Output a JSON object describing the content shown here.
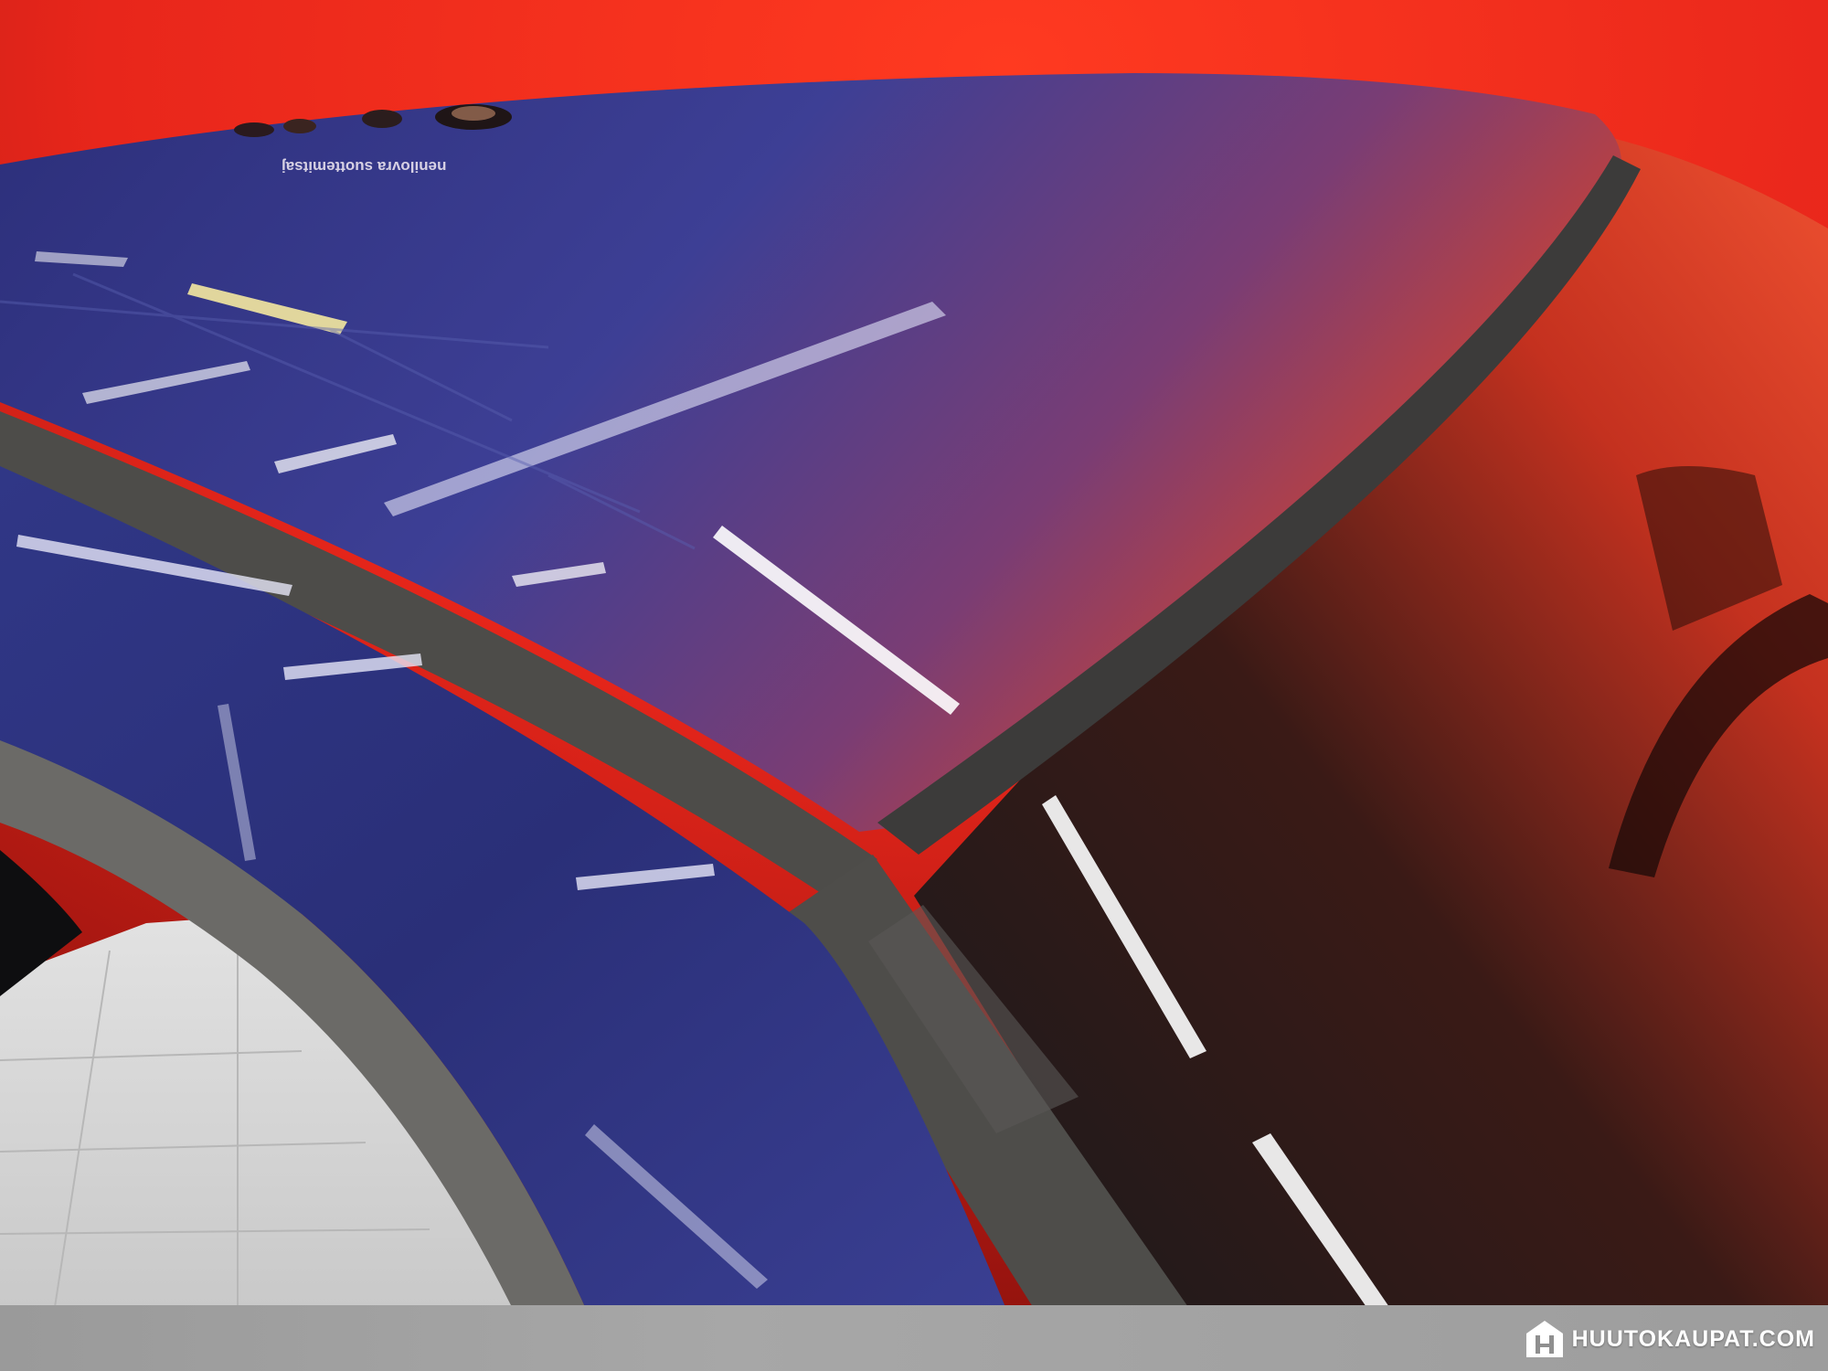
{
  "image": {
    "subject": "car-roof-and-windshield-closeup",
    "background_color": "#e8261b",
    "roof_color": "#3a3d8f",
    "trim_color": "#4a4a48",
    "floor_color": "#d4d4d4"
  },
  "roof_sticker": {
    "text": "nenilovra suottemitsaj"
  },
  "watermark": {
    "brand": "HUUTOKAUPAT.COM",
    "logo_icon": "house-h-logo-icon"
  }
}
